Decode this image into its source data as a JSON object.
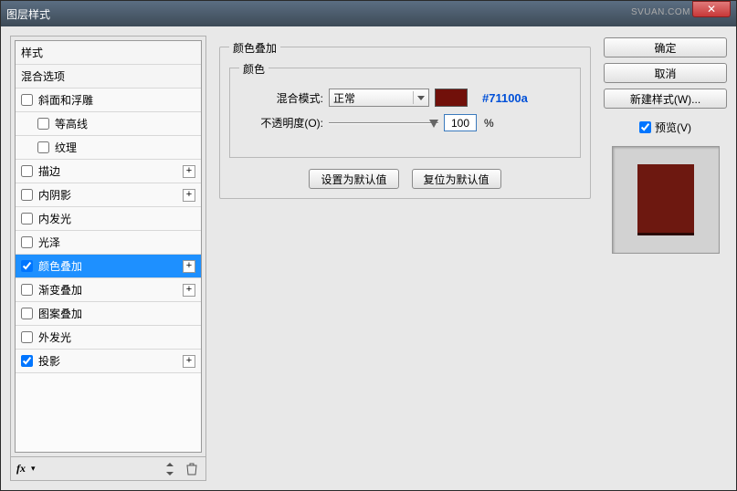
{
  "window": {
    "title": "图层样式",
    "watermark": "SVUAN.COM"
  },
  "styles": {
    "header_styles": "样式",
    "header_blend": "混合选项",
    "items": [
      {
        "label": "斜面和浮雕",
        "checked": false,
        "plus": false,
        "indent": 0
      },
      {
        "label": "等高线",
        "checked": false,
        "plus": false,
        "indent": 1
      },
      {
        "label": "纹理",
        "checked": false,
        "plus": false,
        "indent": 1
      },
      {
        "label": "描边",
        "checked": false,
        "plus": true,
        "indent": 0
      },
      {
        "label": "内阴影",
        "checked": false,
        "plus": true,
        "indent": 0
      },
      {
        "label": "内发光",
        "checked": false,
        "plus": false,
        "indent": 0
      },
      {
        "label": "光泽",
        "checked": false,
        "plus": false,
        "indent": 0
      },
      {
        "label": "颜色叠加",
        "checked": true,
        "plus": true,
        "indent": 0,
        "selected": true
      },
      {
        "label": "渐变叠加",
        "checked": false,
        "plus": true,
        "indent": 0
      },
      {
        "label": "图案叠加",
        "checked": false,
        "plus": false,
        "indent": 0
      },
      {
        "label": "外发光",
        "checked": false,
        "plus": false,
        "indent": 0
      },
      {
        "label": "投影",
        "checked": true,
        "plus": true,
        "indent": 0
      }
    ],
    "footer": {
      "fx": "fx"
    }
  },
  "panel": {
    "group_title": "颜色叠加",
    "color_group": "颜色",
    "blend_mode_label": "混合模式:",
    "blend_mode_value": "正常",
    "color_hex": "#71100a",
    "opacity_label": "不透明度(O):",
    "opacity_value": "100",
    "percent": "%",
    "btn_default": "设置为默认值",
    "btn_reset": "复位为默认值"
  },
  "right": {
    "ok": "确定",
    "cancel": "取消",
    "new_style": "新建样式(W)...",
    "preview": "预览(V)"
  }
}
